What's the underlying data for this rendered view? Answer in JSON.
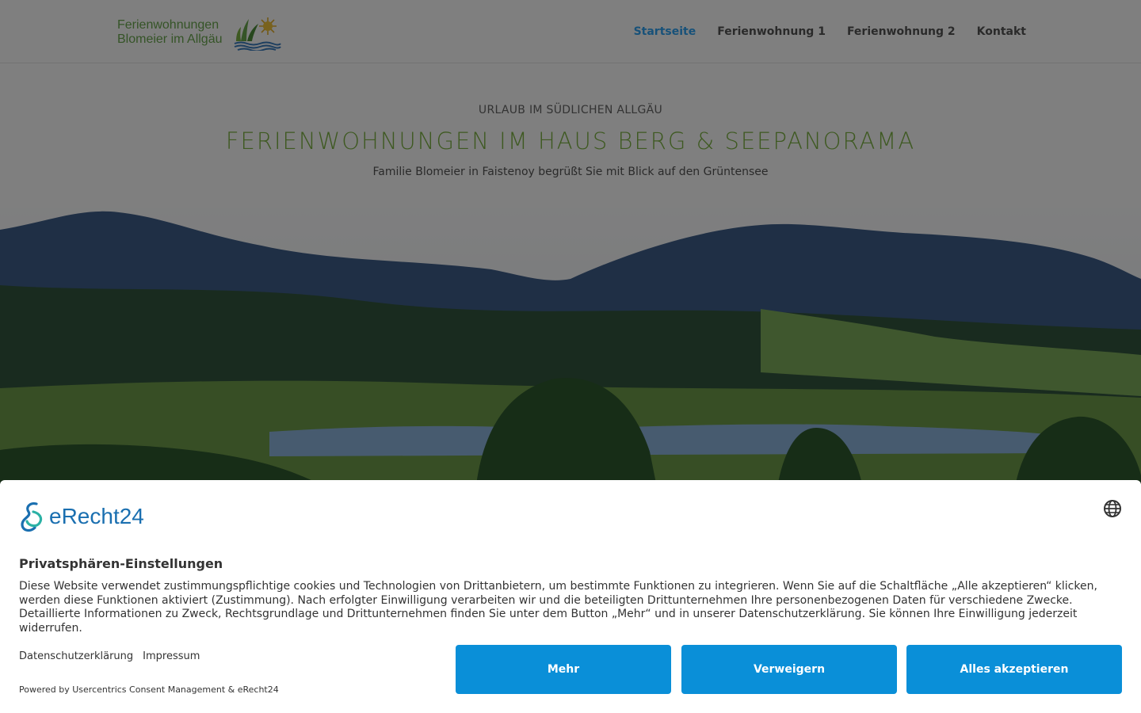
{
  "header": {
    "logo": {
      "line1": "Ferienwohnungen",
      "line2": "Blomeier im Allgäu"
    },
    "nav": [
      {
        "label": "Startseite",
        "active": true
      },
      {
        "label": "Ferienwohnung 1",
        "active": false
      },
      {
        "label": "Ferienwohnung 2",
        "active": false
      },
      {
        "label": "Kontakt",
        "active": false
      }
    ]
  },
  "hero": {
    "eyebrow": "URLAUB IM SÜDLICHEN ALLGÄU",
    "headline": "FERIENWOHNUNGEN IM HAUS BERG & SEEPANORAMA",
    "subline": "Familie Blomeier in Faistenoy begrüßt Sie mit Blick auf den Grüntensee"
  },
  "consent": {
    "brand": "eRecht24",
    "title": "Privatsphären-Einstellungen",
    "body": "Diese Website verwendet zustimmungspflichtige cookies und Technologien von Drittanbietern, um bestimmte Funktionen zu integrieren. Wenn Sie auf die Schaltfläche „Alle akzeptieren“ klicken, werden diese Funktionen aktiviert (Zustimmung). Nach erfolgter Einwilligung verarbeiten wir und die beteiligten Drittunternehmen Ihre personenbezogenen Daten für verschiedene Zwecke. Detaillierte Informationen zu Zweck, Rechtsgrundlage und Drittunternehmen finden Sie unter dem Button „Mehr“ und in unserer Datenschutzerklärung. Sie können Ihre Einwilligung jederzeit widerrufen.",
    "links": {
      "privacy": "Datenschutzerklärung",
      "imprint": "Impressum"
    },
    "powered": "Powered by Usercentrics Consent Management & eRecht24",
    "buttons": {
      "more": "Mehr",
      "deny": "Verweigern",
      "accept": "Alles akzeptieren"
    }
  },
  "colors": {
    "accent": "#2ea3f2",
    "headline": "#7cb342",
    "button": "#0a8fd8"
  }
}
